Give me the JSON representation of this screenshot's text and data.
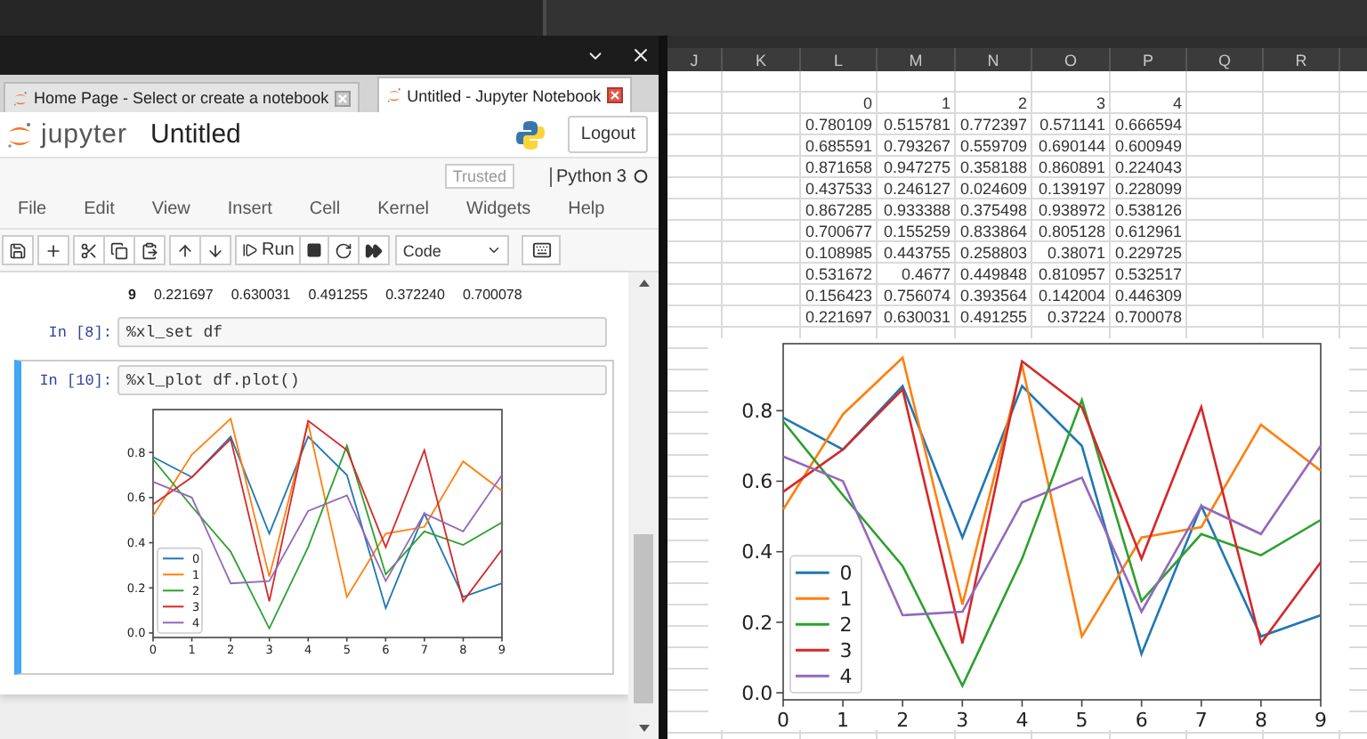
{
  "notebook": {
    "browser_tabs": [
      {
        "label": "Home Page - Select or create a notebook",
        "selected": false
      },
      {
        "label": "Untitled - Jupyter Notebook",
        "selected": true
      }
    ],
    "header": {
      "brand": "jupyter",
      "notebook_name": "Untitled",
      "logout": "Logout"
    },
    "status": {
      "trusted": "Trusted",
      "kernel": "Python 3"
    },
    "menu": [
      "File",
      "Edit",
      "View",
      "Insert",
      "Cell",
      "Kernel",
      "Widgets",
      "Help"
    ],
    "toolbar": {
      "run": "Run",
      "cell_type": "Code"
    },
    "output_row": {
      "index": "9",
      "values": [
        "0.221697",
        "0.630031",
        "0.491255",
        "0.372240",
        "0.700078"
      ]
    },
    "cells": [
      {
        "prompt": "In [8]:",
        "code": "%xl_set df",
        "selected": false
      },
      {
        "prompt": "In [10]:",
        "code": "%xl_plot df.plot()",
        "selected": true,
        "chart_data": {
          "type": "line",
          "legend": "lower left",
          "x": [
            0,
            1,
            2,
            3,
            4,
            5,
            6,
            7,
            8,
            9
          ],
          "xlim": [
            0,
            9
          ],
          "ylim": [
            -0.02,
            0.99
          ],
          "xticks": [
            0,
            1,
            2,
            3,
            4,
            5,
            6,
            7,
            8,
            9
          ],
          "yticks": [
            {
              "value": 0,
              "label": "0.0"
            },
            {
              "value": 0.2,
              "label": "0.2"
            },
            {
              "value": 0.4,
              "label": "0.4"
            },
            {
              "value": 0.6,
              "label": "0.6"
            },
            {
              "value": 0.8,
              "label": "0.8"
            }
          ],
          "series": [
            {
              "name": "0",
              "color": "#1f77b4",
              "values": [
                0.78,
                0.69,
                0.87,
                0.44,
                0.87,
                0.7,
                0.11,
                0.53,
                0.16,
                0.22
              ]
            },
            {
              "name": "1",
              "color": "#ff7f0e",
              "values": [
                0.52,
                0.79,
                0.95,
                0.25,
                0.93,
                0.16,
                0.44,
                0.47,
                0.76,
                0.63
              ]
            },
            {
              "name": "2",
              "color": "#2ca02c",
              "values": [
                0.77,
                0.56,
                0.36,
                0.02,
                0.38,
                0.83,
                0.26,
                0.45,
                0.39,
                0.49
              ]
            },
            {
              "name": "3",
              "color": "#d62728",
              "values": [
                0.57,
                0.69,
                0.86,
                0.14,
                0.94,
                0.81,
                0.38,
                0.81,
                0.14,
                0.37
              ]
            },
            {
              "name": "4",
              "color": "#9467bd",
              "values": [
                0.67,
                0.6,
                0.22,
                0.23,
                0.54,
                0.61,
                0.23,
                0.53,
                0.45,
                0.7
              ]
            }
          ]
        }
      }
    ]
  },
  "spreadsheet": {
    "columns": [
      "J",
      "K",
      "L",
      "M",
      "N",
      "O",
      "P",
      "Q",
      "R"
    ],
    "rows": [
      [
        "",
        "",
        "0",
        "1",
        "2",
        "3",
        "4"
      ],
      [
        "",
        "",
        "0.780109",
        "0.515781",
        "0.772397",
        "0.571141",
        "0.666594"
      ],
      [
        "",
        "",
        "0.685591",
        "0.793267",
        "0.559709",
        "0.690144",
        "0.600949"
      ],
      [
        "",
        "",
        "0.871658",
        "0.947275",
        "0.358188",
        "0.860891",
        "0.224043"
      ],
      [
        "",
        "",
        "0.437533",
        "0.246127",
        "0.024609",
        "0.139197",
        "0.228099"
      ],
      [
        "",
        "",
        "0.867285",
        "0.933388",
        "0.375498",
        "0.938972",
        "0.538126"
      ],
      [
        "",
        "",
        "0.700677",
        "0.155259",
        "0.833864",
        "0.805128",
        "0.612961"
      ],
      [
        "",
        "",
        "0.108985",
        "0.443755",
        "0.258803",
        "0.38071",
        "0.229725"
      ],
      [
        "",
        "",
        "0.531672",
        "0.4677",
        "0.449848",
        "0.810957",
        "0.532517"
      ],
      [
        "",
        "",
        "0.156423",
        "0.756074",
        "0.393564",
        "0.142004",
        "0.446309"
      ],
      [
        "",
        "",
        "0.221697",
        "0.630031",
        "0.491255",
        "0.37224",
        "0.700078"
      ]
    ],
    "chart_data": {
      "type": "line",
      "legend": "lower left",
      "x": [
        0,
        1,
        2,
        3,
        4,
        5,
        6,
        7,
        8,
        9
      ],
      "xlim": [
        0,
        9
      ],
      "ylim": [
        -0.02,
        0.99
      ],
      "xticks": [
        0,
        1,
        2,
        3,
        4,
        5,
        6,
        7,
        8,
        9
      ],
      "yticks": [
        {
          "value": 0,
          "label": "0.0"
        },
        {
          "value": 0.2,
          "label": "0.2"
        },
        {
          "value": 0.4,
          "label": "0.4"
        },
        {
          "value": 0.6,
          "label": "0.6"
        },
        {
          "value": 0.8,
          "label": "0.8"
        }
      ],
      "series": [
        {
          "name": "0",
          "color": "#1f77b4",
          "values": [
            0.78,
            0.69,
            0.87,
            0.44,
            0.87,
            0.7,
            0.11,
            0.53,
            0.16,
            0.22
          ]
        },
        {
          "name": "1",
          "color": "#ff7f0e",
          "values": [
            0.52,
            0.79,
            0.95,
            0.25,
            0.93,
            0.16,
            0.44,
            0.47,
            0.76,
            0.63
          ]
        },
        {
          "name": "2",
          "color": "#2ca02c",
          "values": [
            0.77,
            0.56,
            0.36,
            0.02,
            0.38,
            0.83,
            0.26,
            0.45,
            0.39,
            0.49
          ]
        },
        {
          "name": "3",
          "color": "#d62728",
          "values": [
            0.57,
            0.69,
            0.86,
            0.14,
            0.94,
            0.81,
            0.38,
            0.81,
            0.14,
            0.37
          ]
        },
        {
          "name": "4",
          "color": "#9467bd",
          "values": [
            0.67,
            0.6,
            0.22,
            0.23,
            0.54,
            0.61,
            0.23,
            0.53,
            0.45,
            0.7
          ]
        }
      ]
    }
  }
}
